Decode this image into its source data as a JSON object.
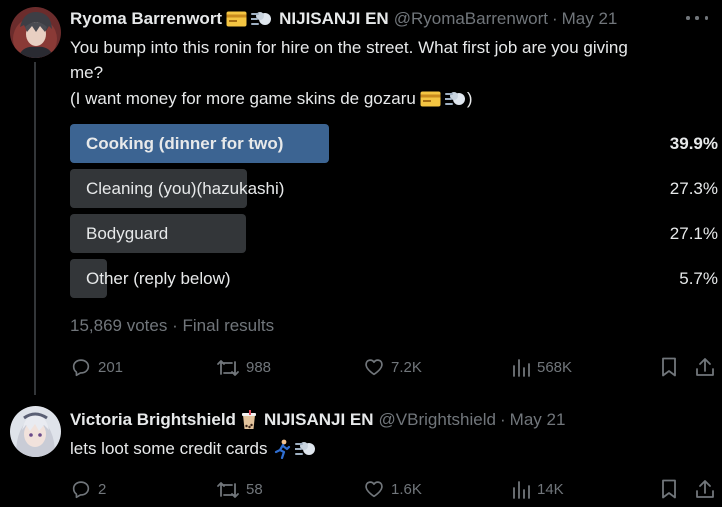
{
  "tweets": [
    {
      "author": "Ryoma Barrenwort",
      "org": "NIJISANJI EN",
      "handle": "@RyomaBarrenwort",
      "separator": "·",
      "date": "May 21",
      "text_lines": [
        "You bump into this ronin for hire on the street. What first job are you giving",
        "me?",
        "(I want money for more game skins de gozaru"
      ],
      "text_suffix": ")",
      "emojis": [
        "credit-card",
        "dash"
      ],
      "poll": {
        "options": [
          {
            "label": "Cooking (dinner for two)",
            "percent_text": "39.9%",
            "percent": 39.9,
            "winner": true
          },
          {
            "label": "Cleaning (you)(hazukashi)",
            "percent_text": "27.3%",
            "percent": 27.3,
            "winner": false
          },
          {
            "label": "Bodyguard",
            "percent_text": "27.1%",
            "percent": 27.1,
            "winner": false
          },
          {
            "label": "Other (reply below)",
            "percent_text": "5.7%",
            "percent": 5.7,
            "winner": false
          }
        ],
        "votes": "15,869 votes",
        "separator": "·",
        "status": "Final results"
      },
      "actions": {
        "replies": "201",
        "retweets": "988",
        "likes": "7.2K",
        "views": "568K"
      }
    },
    {
      "author": "Victoria Brightshield",
      "org": "NIJISANJI EN",
      "handle": "@VBrightshield",
      "separator": "·",
      "date": "May 21",
      "text": "lets loot some credit cards",
      "emojis": [
        "bubble-tea",
        "runner",
        "dash"
      ],
      "actions": {
        "replies": "2",
        "retweets": "58",
        "likes": "1.6K",
        "views": "14K"
      }
    }
  ],
  "colors": {
    "background": "#000000",
    "text": "#e7e9ea",
    "muted": "#71767b",
    "poll_winner": "#3c6492",
    "poll_other": "#333639"
  }
}
